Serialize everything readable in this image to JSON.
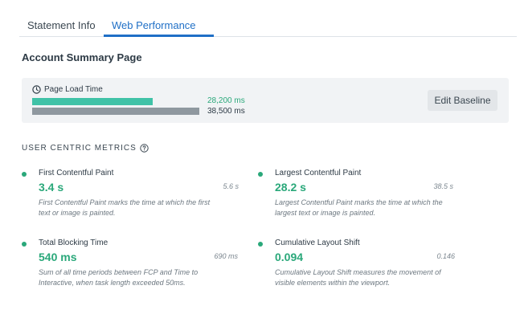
{
  "tabs": [
    {
      "label": "Statement Info",
      "active": false
    },
    {
      "label": "Web Performance",
      "active": true
    }
  ],
  "page_title": "Account Summary Page",
  "page_load": {
    "label": "Page Load Time",
    "current": {
      "value_ms": 28200,
      "label": "28,200 ms",
      "color": "#40c2a7"
    },
    "baseline": {
      "value_ms": 38500,
      "label": "38,500 ms",
      "color": "#8f989f"
    },
    "edit_button": "Edit Baseline"
  },
  "section_header": "USER CENTRIC METRICS",
  "metrics": [
    {
      "name": "First Contentful Paint",
      "value": "3.4 s",
      "baseline": "5.6 s",
      "description": "First Contentful Paint marks the time at which the first text or image is painted."
    },
    {
      "name": "Largest Contentful Paint",
      "value": "28.2 s",
      "baseline": "38.5 s",
      "description": "Largest Contentful Paint marks the time at which the largest text or image is painted."
    },
    {
      "name": "Total Blocking Time",
      "value": "540 ms",
      "baseline": "690 ms",
      "description": "Sum of all time periods between FCP and Time to Interactive, when task length exceeded 50ms."
    },
    {
      "name": "Cumulative Layout Shift",
      "value": "0.094",
      "baseline": "0.146",
      "description": "Cumulative Layout Shift measures the movement of visible elements within the viewport."
    }
  ],
  "colors": {
    "accent_blue": "#1f6fc6",
    "good_green": "#2aa87a"
  },
  "icons": {
    "page_load": "clock-icon",
    "section_help": "help-circle-icon",
    "metric_status": "status-dot-icon"
  }
}
